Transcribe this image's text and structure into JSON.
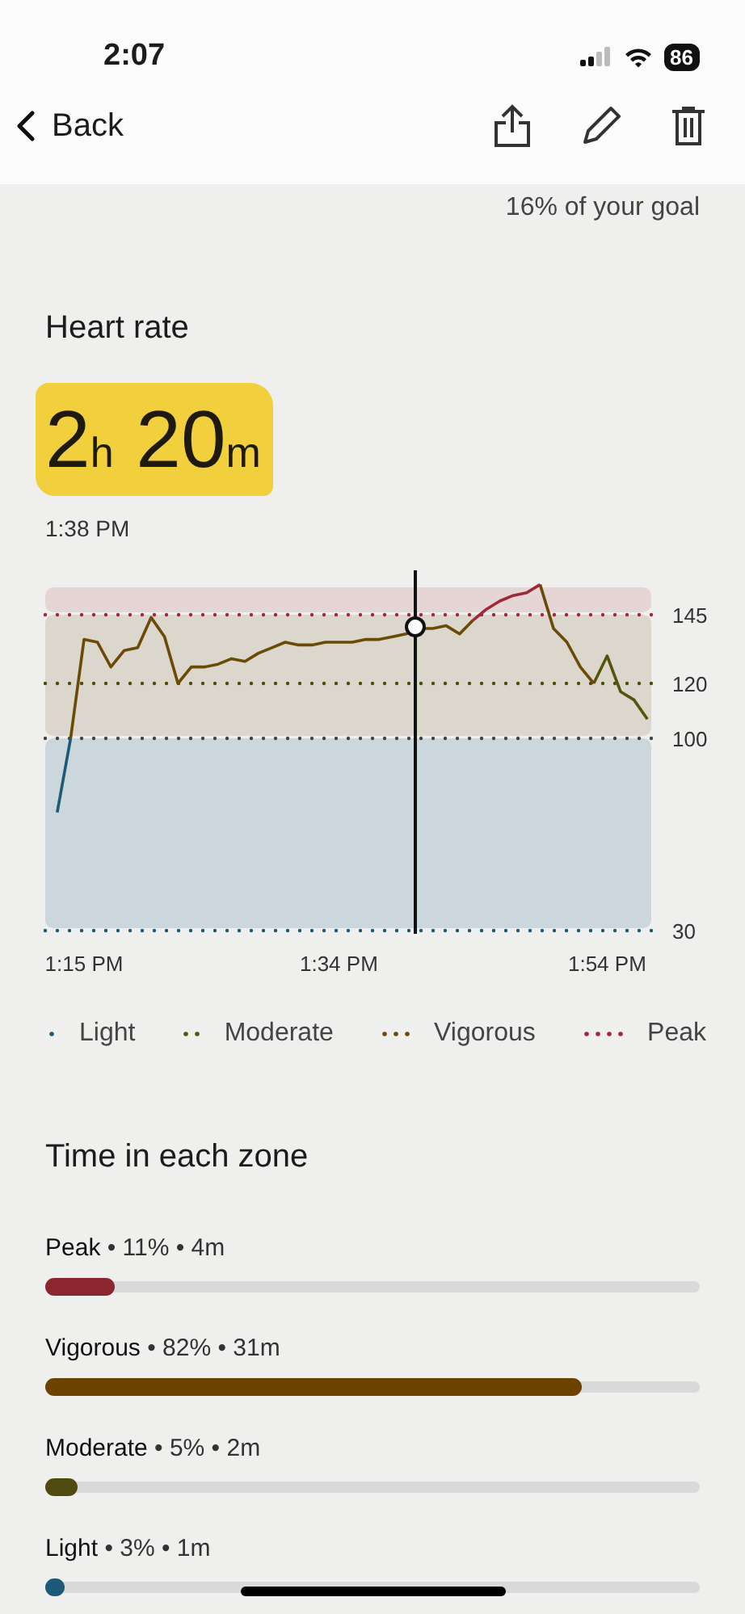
{
  "status_bar": {
    "time": "2:07",
    "battery": "86"
  },
  "nav": {
    "back": "Back"
  },
  "goal": "16% of your goal",
  "heart_rate": {
    "title": "Heart rate",
    "hours": "2",
    "hours_unit": "h",
    "minutes": "20",
    "minutes_unit": "m",
    "time": "1:38 PM",
    "chart_data": {
      "type": "line",
      "categories": [
        null,
        null,
        "1:15 PM",
        null,
        null,
        null,
        null,
        null,
        null,
        null,
        null,
        null,
        null,
        null,
        null,
        null,
        null,
        null,
        null,
        null,
        null,
        "1:34 PM",
        null,
        null,
        null,
        null,
        null,
        null,
        null,
        null,
        null,
        null,
        null,
        null,
        null,
        null,
        null,
        null,
        null,
        null,
        null,
        "1:54 PM",
        null,
        null,
        null
      ],
      "series": [
        {
          "name": "Light",
          "color": "#1d5a78",
          "values": [
            73,
            100,
            null,
            null,
            null,
            null,
            null,
            null,
            null,
            null,
            null,
            null,
            null,
            null,
            null,
            null,
            null,
            null,
            null,
            null,
            null,
            null,
            null,
            null,
            null,
            null,
            null,
            null,
            null,
            null,
            null,
            null,
            null,
            null,
            null,
            null,
            null,
            null,
            null,
            null,
            null,
            null,
            null,
            null,
            null
          ]
        },
        {
          "name": "Moderate",
          "color": "#58520f",
          "values": [
            null,
            null,
            null,
            null,
            null,
            null,
            null,
            null,
            null,
            null,
            null,
            null,
            null,
            null,
            null,
            null,
            null,
            null,
            null,
            null,
            null,
            null,
            null,
            null,
            null,
            null,
            null,
            null,
            null,
            null,
            null,
            null,
            null,
            null,
            null,
            null,
            null,
            null,
            null,
            null,
            120,
            130,
            117,
            114,
            107
          ]
        },
        {
          "name": "Vigorous",
          "color": "#6b4a06",
          "values": [
            null,
            100,
            136,
            135,
            126,
            132,
            133,
            144,
            137,
            120,
            126,
            126,
            127,
            129,
            128,
            131,
            133,
            135,
            134,
            134,
            135,
            135,
            135,
            136,
            136,
            137,
            138,
            140,
            140,
            141,
            138,
            143,
            null,
            null,
            null,
            null,
            156,
            140,
            135,
            126,
            120,
            null,
            null,
            null,
            null
          ]
        },
        {
          "name": "Peak",
          "color": "#a0283a",
          "values": [
            null,
            null,
            null,
            null,
            null,
            null,
            null,
            null,
            null,
            null,
            null,
            null,
            null,
            null,
            null,
            null,
            null,
            null,
            null,
            null,
            null,
            null,
            null,
            null,
            null,
            null,
            null,
            null,
            null,
            null,
            null,
            143,
            147,
            150,
            152,
            153,
            156,
            null,
            null,
            null,
            null,
            null,
            null,
            null,
            null
          ]
        }
      ],
      "bands": [
        {
          "axis": "y",
          "from": 145,
          "to": 155,
          "color": "#e6d5d5"
        },
        {
          "axis": "y",
          "from": 100,
          "to": 145,
          "color": "#dcd7cd"
        },
        {
          "axis": "y",
          "from": 30,
          "to": 100,
          "color": "#cbd7dd"
        }
      ],
      "ylim": [
        30,
        160
      ],
      "yticks": [
        30,
        100,
        120,
        145
      ]
    }
  },
  "zones": {
    "title": "Time in each zone",
    "rows": [
      {
        "label": "**Peak** • 11% • 4m",
        "level": 0.105,
        "color": "#8b2530"
      },
      {
        "label": "**Vigorous** • 82% • 31m",
        "level": 0.82,
        "color": "#6b4200"
      },
      {
        "label": "**Moderate** • 5% • 2m",
        "level": 0.05,
        "color": "#4f4a0e"
      },
      {
        "label": "**Light** • 3% • 1m",
        "level": 0.03,
        "color": "#1d5a78"
      }
    ]
  }
}
